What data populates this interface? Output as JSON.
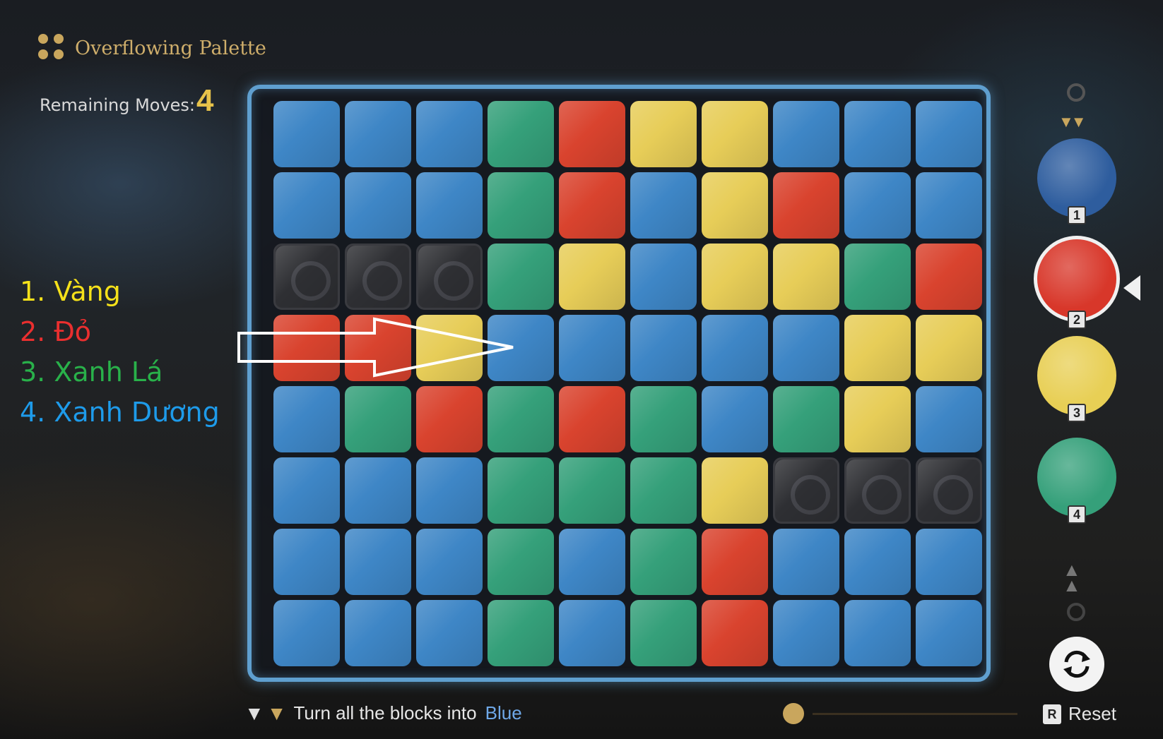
{
  "header": {
    "title": "Overflowing Palette",
    "moves_label": "Remaining Moves:",
    "moves_value": "4"
  },
  "legend": [
    {
      "text": "1. Vàng",
      "color": "#f5e11a"
    },
    {
      "text": "2. Đỏ",
      "color": "#ea2f2f"
    },
    {
      "text": "3. Xanh Lá",
      "color": "#29b14a"
    },
    {
      "text": "4. Xanh Dương",
      "color": "#1e9bea"
    }
  ],
  "board": {
    "rows": [
      [
        "blue",
        "blue",
        "blue",
        "green",
        "red",
        "yellow",
        "yellow",
        "blue",
        "blue",
        "blue"
      ],
      [
        "blue",
        "blue",
        "blue",
        "green",
        "red",
        "blue",
        "yellow",
        "red",
        "blue",
        "blue"
      ],
      [
        "rock",
        "rock",
        "rock",
        "green",
        "yellow",
        "blue",
        "yellow",
        "yellow",
        "green",
        "red"
      ],
      [
        "red",
        "red",
        "yellow",
        "blue",
        "blue",
        "blue",
        "blue",
        "blue",
        "yellow",
        "yellow"
      ],
      [
        "blue",
        "green",
        "red",
        "green",
        "red",
        "green",
        "blue",
        "green",
        "yellow",
        "blue"
      ],
      [
        "blue",
        "blue",
        "blue",
        "green",
        "green",
        "green",
        "yellow",
        "rock",
        "rock",
        "rock"
      ],
      [
        "blue",
        "blue",
        "blue",
        "green",
        "blue",
        "green",
        "red",
        "blue",
        "blue",
        "blue"
      ],
      [
        "blue",
        "blue",
        "blue",
        "green",
        "blue",
        "green",
        "red",
        "blue",
        "blue",
        "blue"
      ]
    ]
  },
  "palette": [
    {
      "number": "1",
      "color_name": "blue",
      "color": "#2e5d9e",
      "selected": false
    },
    {
      "number": "2",
      "color_name": "red",
      "color": "#d8372a",
      "selected": true
    },
    {
      "number": "3",
      "color_name": "yellow",
      "color": "#e8cf55",
      "selected": false
    },
    {
      "number": "4",
      "color_name": "green",
      "color": "#35a07a",
      "selected": false
    }
  ],
  "footer": {
    "objective_prefix": "Turn all the blocks into",
    "objective_target": "Blue"
  },
  "reset": {
    "key": "R",
    "label": "Reset"
  },
  "icons": [
    "palette-logo-icon",
    "swap-cycle-icon",
    "arrow-right-icon",
    "double-triangle-icon"
  ]
}
